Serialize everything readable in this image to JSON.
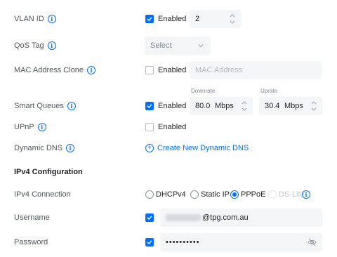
{
  "colors": {
    "accent": "#006fff",
    "label": "#50565e",
    "field_bg": "#f4f5f6",
    "placeholder": "#b6b9bf"
  },
  "rows": {
    "vlan": {
      "label": "VLAN ID",
      "enabled": true,
      "enabled_label": "Enabled",
      "value": "2"
    },
    "qos": {
      "label": "QoS Tag",
      "select_value": "Select"
    },
    "mac": {
      "label": "MAC Address Clone",
      "enabled": false,
      "enabled_label": "Enabled",
      "placeholder": "MAC Address"
    },
    "smart_queues": {
      "label": "Smart Queues",
      "enabled": true,
      "enabled_label": "Enabled",
      "downrate_label": "Downrate",
      "downrate_value": "80.0",
      "downrate_unit": "Mbps",
      "uprate_label": "Uprate",
      "uprate_value": "30.4",
      "uprate_unit": "Mbps"
    },
    "upnp": {
      "label": "UPnP",
      "enabled": false,
      "enabled_label": "Enabled"
    },
    "ddns": {
      "label": "Dynamic DNS",
      "link_label": "Create New Dynamic DNS",
      "link_icon": "plus-circle-icon"
    },
    "ipv4_section": {
      "title": "IPv4 Configuration"
    },
    "ipv4_conn": {
      "label": "IPv4 Connection",
      "options": [
        "DHCPv4",
        "Static IP",
        "PPPoE",
        "DS-Lite"
      ],
      "selected": "PPPoE",
      "disabled": [
        "DS-Lite"
      ]
    },
    "username": {
      "label": "Username",
      "checked": true,
      "value_suffix": "@tpg.com.au"
    },
    "password": {
      "label": "Password",
      "checked": true,
      "value": "••••••••••",
      "toggle_icon": "eye-off-icon"
    }
  }
}
